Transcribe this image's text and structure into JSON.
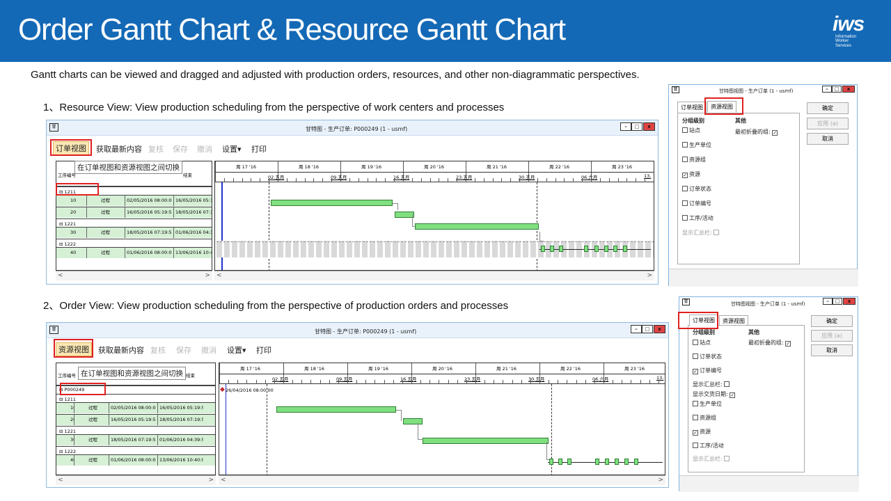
{
  "slide": {
    "title": "Order Gantt Chart & Resource Gantt Chart",
    "intro": "Gantt charts can be viewed and dragged and adjusted with production orders, resources, and other non-diagrammatic perspectives.",
    "section1": "1、Resource View: View production scheduling from the perspective of work centers and processes",
    "section2": "2、Order View: View production scheduling from the perspective of production orders and processes"
  },
  "logo": {
    "mark": "iws",
    "line1": "Information",
    "line2": "Worker",
    "line3": "Services"
  },
  "gantt_window": {
    "icon": "甘",
    "title": "甘特图 - 生产订单: P000249 (1 - usmf)",
    "minimize": "–",
    "maximize": "□",
    "close": "x",
    "toolbar": {
      "refresh": "获取最新内容",
      "review": "复核",
      "save": "保存",
      "undo": "撤消",
      "settings": "设置▾",
      "print": "打印"
    },
    "tooltip": "在订单视图和资源视图之间切换",
    "columns": {
      "op": "工序编号",
      "type": "任务类型",
      "start": "开始",
      "end": "结束"
    },
    "weeks": [
      "周 17 '16",
      "周 18 '16",
      "周 19 '16",
      "周 20 '16",
      "周 21 '16",
      "周 22 '16",
      "周 23 '16",
      "周 2"
    ],
    "days": [
      "02.五月",
      "09.五月",
      "16.五月",
      "23.五月",
      "30.五月",
      "06.六月",
      "13."
    ],
    "scroll_left": "<",
    "scroll_right": ">"
  },
  "view1": {
    "toggle": "订单视图",
    "rows": [
      {
        "kind": "group",
        "label": "⊟ 1211"
      },
      {
        "kind": "data",
        "op": "10",
        "type": "过程",
        "start": "02/05/2016 08:00:0",
        "end": "16/05/2016 05:19:5"
      },
      {
        "kind": "data",
        "op": "20",
        "type": "过程",
        "start": "16/05/2016 05:19:5",
        "end": "18/05/2016 07:19:5"
      },
      {
        "kind": "group",
        "label": "⊟ 1221"
      },
      {
        "kind": "data",
        "op": "30",
        "type": "过程",
        "start": "18/05/2016 07:19:5",
        "end": "01/06/2016 04:39:5"
      },
      {
        "kind": "group",
        "label": "⊟ 1222"
      },
      {
        "kind": "data",
        "op": "40",
        "type": "过程",
        "start": "01/06/2016 08:00:0",
        "end": "13/06/2016 10:40:0"
      }
    ]
  },
  "view2": {
    "toggle": "资源视图",
    "order_row": "⊟ P000249",
    "milestone": "26/04/2016 08:00:00",
    "rows": [
      {
        "kind": "group",
        "label": "⊟ 1211"
      },
      {
        "kind": "data",
        "op": "10",
        "type": "过程",
        "start": "02/05/2016 08:00:0",
        "end": "16/05/2016 05:19:5"
      },
      {
        "kind": "data",
        "op": "20",
        "type": "过程",
        "start": "16/05/2016 05:19:5",
        "end": "18/05/2016 07:19:5"
      },
      {
        "kind": "group",
        "label": "⊟ 1221"
      },
      {
        "kind": "data",
        "op": "30",
        "type": "过程",
        "start": "18/05/2016 07:19:5",
        "end": "01/06/2016 04:39:5"
      },
      {
        "kind": "group",
        "label": "⊟ 1222"
      },
      {
        "kind": "data",
        "op": "40",
        "type": "过程",
        "start": "01/06/2016 08:00:0",
        "end": "13/06/2016 10:40:0"
      }
    ]
  },
  "dialog": {
    "icon": "甘",
    "title": "甘特图视图 - 生产订单 (1 - usmf)",
    "tab_order": "订单视图",
    "tab_resource": "资源视图",
    "group_level": "分组级别",
    "other": "其他",
    "ok": "确定",
    "apply": "应用 (a)",
    "cancel": "取消",
    "collapse_label": "最初折叠的组:",
    "show_summary": "显示汇总栏:",
    "show_delivery": "显示交货日期:",
    "d1_items": [
      {
        "label": "站点",
        "checked": false
      },
      {
        "label": "生产单位",
        "checked": false
      },
      {
        "label": "资源组",
        "checked": false
      },
      {
        "label": "资源",
        "checked": true
      },
      {
        "label": "订单状态",
        "checked": false
      },
      {
        "label": "订单编号",
        "checked": false
      },
      {
        "label": "工序/活动",
        "checked": false
      }
    ],
    "d2_items_top": [
      {
        "label": "站点",
        "checked": false
      },
      {
        "label": "订单状态",
        "checked": false
      },
      {
        "label": "订单编号",
        "checked": true
      }
    ],
    "d2_items_bottom": [
      {
        "label": "生产单位",
        "checked": false
      },
      {
        "label": "资源组",
        "checked": false
      },
      {
        "label": "资源",
        "checked": true
      },
      {
        "label": "工序/活动",
        "checked": false
      }
    ]
  }
}
